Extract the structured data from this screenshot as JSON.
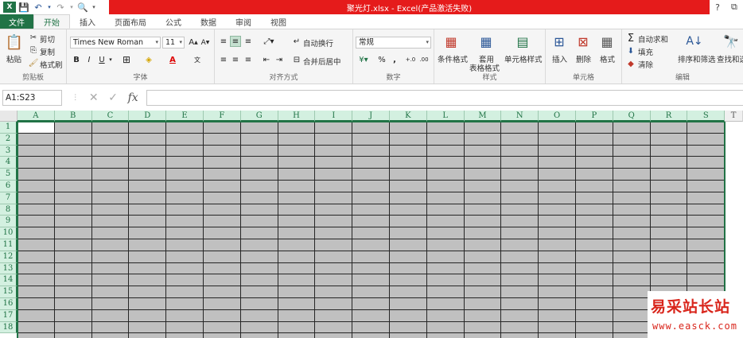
{
  "title": {
    "text": "聚光灯.xlsx - Excel(产品激活失败)",
    "help": "?",
    "restore": "⧉"
  },
  "tabs": [
    "文件",
    "开始",
    "插入",
    "页面布局",
    "公式",
    "数据",
    "审阅",
    "视图"
  ],
  "ribbon": {
    "clipboard": {
      "paste": "粘贴",
      "cut": "剪切",
      "copy": "复制",
      "format_painter": "格式刷",
      "label": "剪贴板"
    },
    "font": {
      "name": "Times New Roman",
      "size": "11",
      "bold": "B",
      "italic": "I",
      "underline": "U",
      "label": "字体"
    },
    "align": {
      "wrap": "自动换行",
      "merge": "合并后居中",
      "label": "对齐方式"
    },
    "number": {
      "format": "常规",
      "percent": "%",
      "comma": ",",
      "label": "数字"
    },
    "styles": {
      "cond": "条件格式",
      "table1": "套用",
      "table2": "表格格式",
      "cell": "单元格样式",
      "label": "样式"
    },
    "cells": {
      "insert": "插入",
      "delete": "删除",
      "format": "格式",
      "label": "单元格"
    },
    "editing": {
      "autosum": "自动求和",
      "fill": "填充",
      "clear": "清除",
      "sort": "排序和筛选",
      "find": "查找和选",
      "label": "编辑"
    }
  },
  "formula_bar": {
    "name_box": "A1:S23",
    "fx": "fx",
    "value": ""
  },
  "grid": {
    "columns": [
      "A",
      "B",
      "C",
      "D",
      "E",
      "F",
      "G",
      "H",
      "I",
      "J",
      "K",
      "L",
      "M",
      "N",
      "O",
      "P",
      "Q",
      "R",
      "S",
      "T"
    ],
    "rows": [
      "1",
      "2",
      "3",
      "4",
      "5",
      "6",
      "7",
      "8",
      "9",
      "10",
      "11",
      "12",
      "13",
      "14",
      "15",
      "16",
      "17",
      "18"
    ],
    "selection_fill": "#c0c0c0",
    "accent": "#217346"
  },
  "watermark": {
    "title": "易采站长站",
    "url": "www.easck.com"
  },
  "colors": {
    "title_bar": "#e51b1b",
    "file_tab": "#217346"
  }
}
